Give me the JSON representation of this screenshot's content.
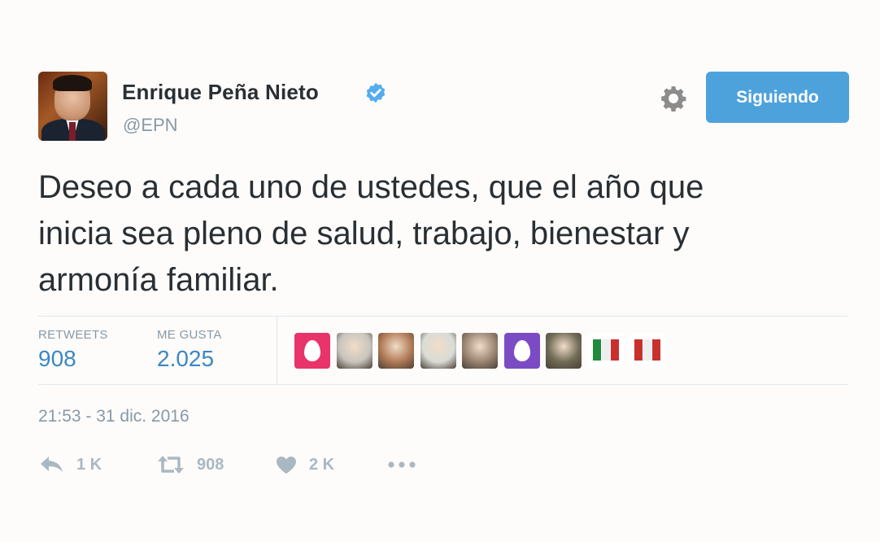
{
  "tweet": {
    "author_name": "Enrique Peña Nieto",
    "handle": "@EPN",
    "follow_button_label": "Siguiendo",
    "text_lines": [
      "Deseo a cada uno de ustedes, que el año que",
      "inicia sea pleno de salud, trabajo, bienestar y",
      "armonía familiar."
    ],
    "stats": {
      "retweets_label": "RETWEETS",
      "retweets_value": "908",
      "likes_label": "ME GUSTA",
      "likes_value": "2.025"
    },
    "likers": [
      {
        "kind": "egg",
        "color": "#e8336b"
      },
      {
        "kind": "photo",
        "color": "#c8c4bd"
      },
      {
        "kind": "photo",
        "color": "#b07a55"
      },
      {
        "kind": "photo",
        "color": "#d9dcd6"
      },
      {
        "kind": "photo",
        "color": "#9a8472"
      },
      {
        "kind": "egg",
        "color": "#7b4bc4"
      },
      {
        "kind": "photo",
        "color": "#6f6a55"
      },
      {
        "kind": "logo",
        "color": "#1f8a3c"
      },
      {
        "kind": "logo",
        "color": "#c9302c"
      }
    ],
    "timestamp": "21:53 - 31 dic. 2016",
    "actions": {
      "reply_count": "1 K",
      "retweet_count": "908",
      "like_count": "2 K"
    },
    "colors": {
      "follow_button": "#4ea2dc",
      "verified_badge": "#55acee",
      "stat_value": "#3b88c3",
      "muted": "#8899a6"
    },
    "icons": [
      "verified-badge-icon",
      "gear-icon",
      "reply-icon",
      "retweet-icon",
      "heart-icon",
      "more-icon"
    ]
  }
}
